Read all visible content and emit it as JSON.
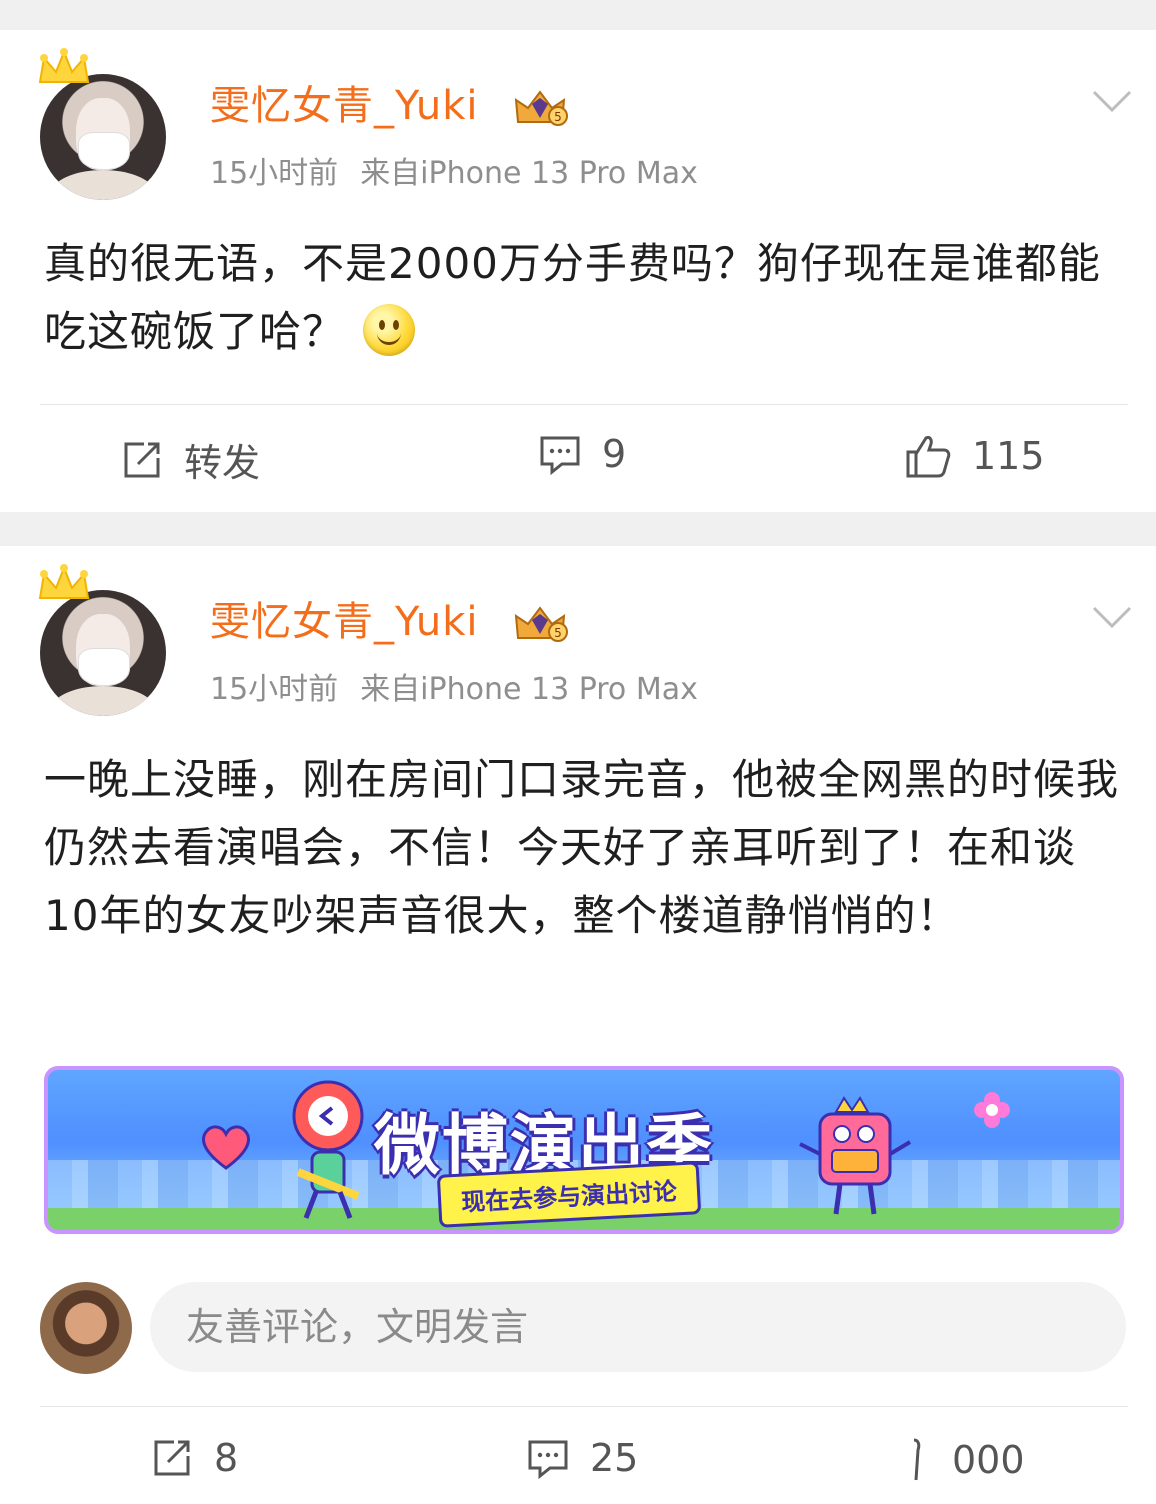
{
  "posts": [
    {
      "username": "雯忆女青_Yuki",
      "time": "15小时前",
      "source": "来自iPhone 13 Pro Max",
      "text": "真的很无语，不是2000万分手费吗？狗仔现在是谁都能吃这碗饭了哈？",
      "actions": {
        "repost": "转发",
        "comments": "9",
        "likes": "115"
      }
    },
    {
      "username": "雯忆女青_Yuki",
      "time": "15小时前",
      "source": "来自iPhone 13 Pro Max",
      "text": "一晚上没睡，刚在房间门口录完音，他被全网黑的时候我仍然去看演唱会，不信！今天好了亲耳听到了！在和谈10年的女友吵架声音很大，整个楼道静悄悄的！",
      "banner": {
        "title": "微博演出季",
        "subtitle": "现在去参与演出讨论"
      },
      "comment_placeholder": "友善评论，文明发言",
      "actions": {
        "reposts": "8",
        "comments": "25",
        "likes": "000"
      }
    }
  ],
  "icons": [
    "crown-icon",
    "vip-badge-icon",
    "chevron-down-icon",
    "repost-icon",
    "comment-icon",
    "like-icon",
    "smile-emoji-icon"
  ],
  "colors": {
    "username": "#f46d1b",
    "meta": "#8e8e8e",
    "background": "#f0f0f0"
  }
}
